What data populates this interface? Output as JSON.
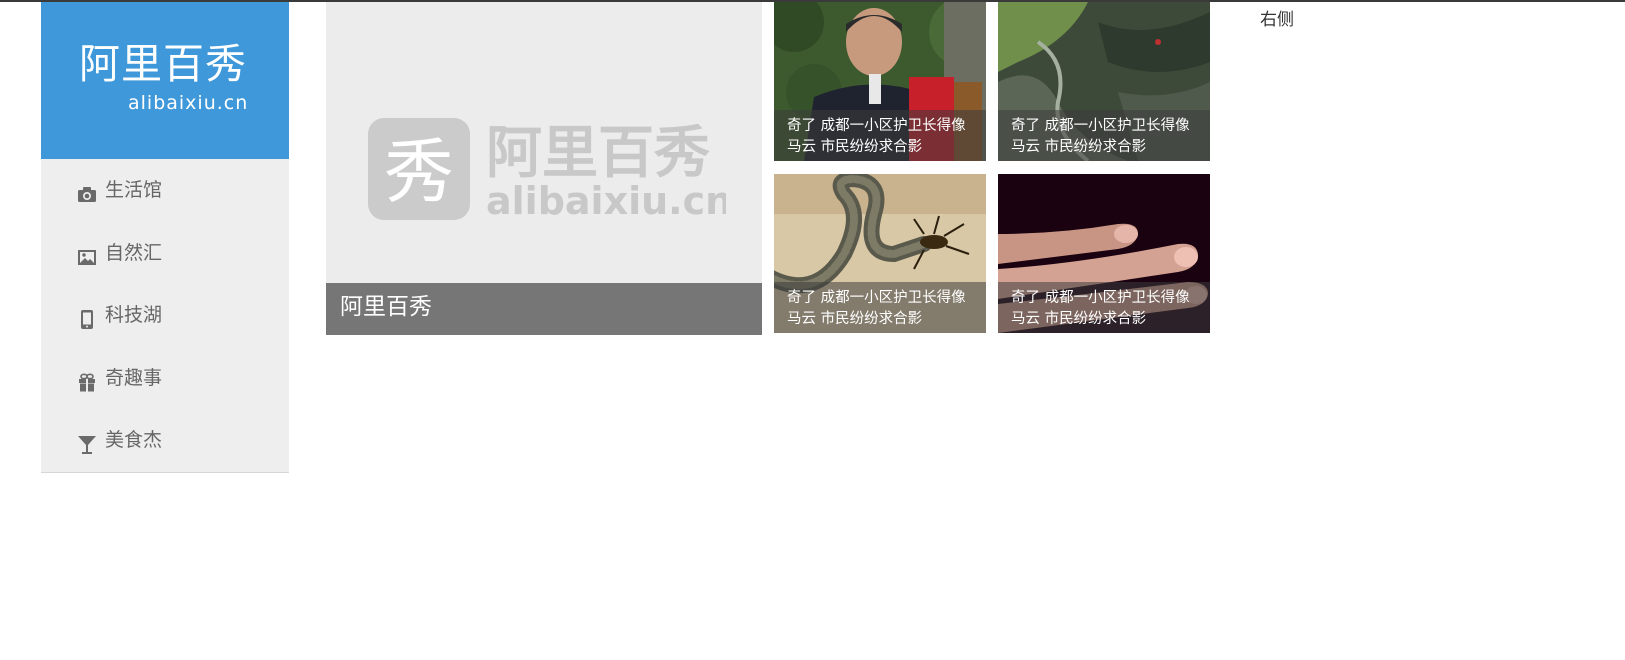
{
  "logo": {
    "title_cn": "阿里百秀",
    "title_en": "alibaixiu.cn"
  },
  "nav": {
    "items": [
      {
        "label": "生活馆",
        "icon": "camera-icon"
      },
      {
        "label": "自然汇",
        "icon": "image-icon"
      },
      {
        "label": "科技湖",
        "icon": "phone-icon"
      },
      {
        "label": "奇趣事",
        "icon": "gift-icon"
      },
      {
        "label": "美食杰",
        "icon": "cocktail-icon"
      }
    ]
  },
  "feature": {
    "caption": "阿里百秀",
    "watermark_char": "秀",
    "watermark_cn": "阿里百秀",
    "watermark_en": "alibaixiu.cn"
  },
  "thumbs": [
    {
      "caption": "奇了 成都一小区护卫长得像马云 市民纷纷求合影"
    },
    {
      "caption": "奇了 成都一小区护卫长得像马云 市民纷纷求合影"
    },
    {
      "caption": "奇了 成都一小区护卫长得像马云 市民纷纷求合影"
    },
    {
      "caption": "奇了 成都一小区护卫长得像马云 市民纷纷求合影"
    }
  ],
  "right": {
    "label": "右侧"
  },
  "colors": {
    "brand_blue": "#3f98d9",
    "sidebar_bg": "#eeeeee",
    "icon_gray": "#6a6a6a"
  }
}
